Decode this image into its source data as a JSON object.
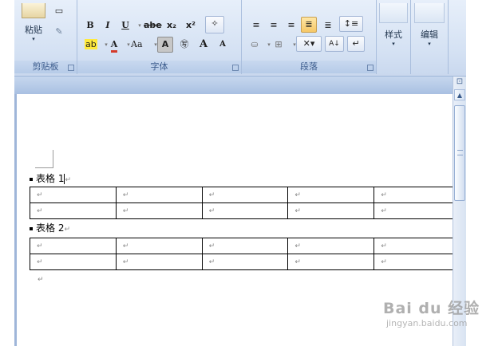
{
  "ribbon": {
    "clipboard": {
      "label": "剪贴板",
      "paste_label": "粘贴"
    },
    "font": {
      "label": "字体",
      "bold": "B",
      "italic": "I",
      "underline": "U",
      "strike": "abe",
      "subscript": "x₂",
      "superscript": "x²",
      "highlight": "ab",
      "font_color": "A",
      "change_case": "Aa",
      "char_shading": "A",
      "enclose": "㊢",
      "grow": "A",
      "shrink": "A"
    },
    "paragraph": {
      "label": "段落",
      "sort": "A↓",
      "pilcrow": "↵"
    },
    "styles": {
      "label": "样式"
    },
    "editing": {
      "label": "编辑"
    }
  },
  "document": {
    "heading1": "表格 1",
    "heading2": "表格 2",
    "cell_mark": "↵",
    "columns": 5,
    "table1_rows": 2,
    "table2_rows": 2
  },
  "watermark": {
    "logo": "Bai du 经验",
    "sub": "jingyan.baidu.com"
  },
  "colors": {
    "ribbon_bg": "#d4e1f3",
    "highlight": "#ffea3c",
    "font_red": "#d43a2a",
    "active_btn": "#f6c766"
  }
}
